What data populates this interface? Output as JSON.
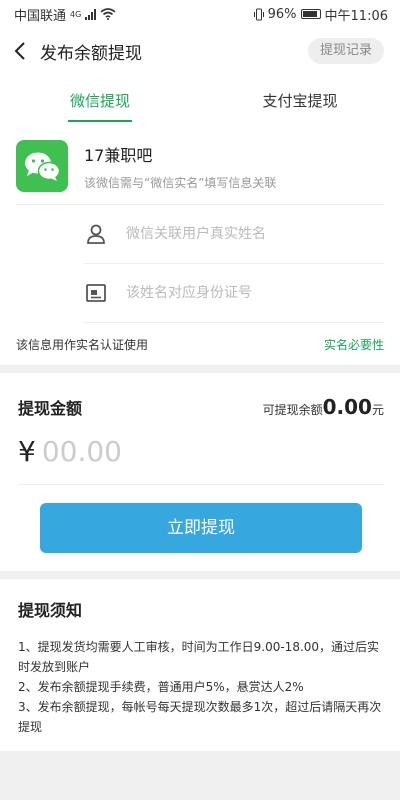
{
  "status_bar": {
    "carrier": "中国联通",
    "network_type": "4G",
    "battery": "96%",
    "time": "中午11:06"
  },
  "header": {
    "back_icon": "chevron-left-icon",
    "title": "发布余额提现",
    "record_button": "提现记录"
  },
  "tabs": [
    {
      "label": "微信提现",
      "active": true
    },
    {
      "label": "支付宝提现",
      "active": false
    }
  ],
  "wechat_account": {
    "icon": "wechat-logo-icon",
    "name": "17兼职吧",
    "hint": "该微信需与“微信实名”填写信息关联"
  },
  "form": {
    "name_placeholder": "微信关联用户真实姓名",
    "id_placeholder": "该姓名对应身份证号",
    "notice": "该信息用作实名认证使用",
    "notice_link": "实名必要性"
  },
  "amount": {
    "title": "提现金额",
    "available_label": "可提现余额",
    "available_value": "0.00",
    "available_unit": "元",
    "currency_symbol": "¥",
    "input_placeholder": "00.00",
    "submit_button": "立即提现"
  },
  "rules": {
    "title": "提现须知",
    "items": [
      "1、提现发货均需要人工审核，时间为工作日9.00-18.00，通过后实时发放到账户",
      "2、发布余额提现手续费，普通用户5%，悬赏达人2%",
      "3、发布余额提现，每帐号每天提现次数最多1次，超过后请隔天再次提现"
    ]
  },
  "colors": {
    "accent_green": "#1aa55a",
    "button_blue": "#37a7df",
    "wechat_green": "#3fc050"
  }
}
